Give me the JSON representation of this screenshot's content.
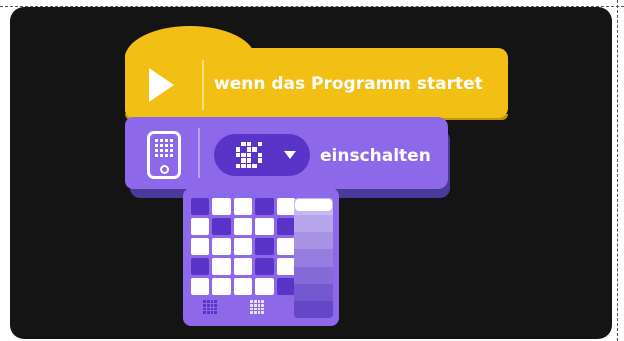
{
  "hat_block": {
    "label": "wenn das Programm startet",
    "color": "#f2bf15",
    "icon": "play-icon"
  },
  "light_block": {
    "label": "einschalten",
    "color": "#8d68e8",
    "icon": "hub-icon",
    "dropdown_icon": "chevron-down-icon"
  },
  "pixel_editor": {
    "selected_color": "#ffffff",
    "off_color": "#5a34c9",
    "pattern": [
      [
        0,
        1,
        1,
        0,
        1
      ],
      [
        1,
        0,
        1,
        1,
        0
      ],
      [
        1,
        1,
        1,
        0,
        1
      ],
      [
        0,
        1,
        1,
        0,
        1
      ],
      [
        1,
        1,
        1,
        1,
        0
      ]
    ],
    "brightness_levels": [
      "#c7b9f0",
      "#b8a6ec",
      "#a792e6",
      "#957ee0",
      "#846bd8",
      "#7458cf",
      "#6446c6"
    ],
    "brightness_value": 1.0,
    "presets": [
      "dim-preset-icon",
      "full-preset-icon"
    ]
  }
}
